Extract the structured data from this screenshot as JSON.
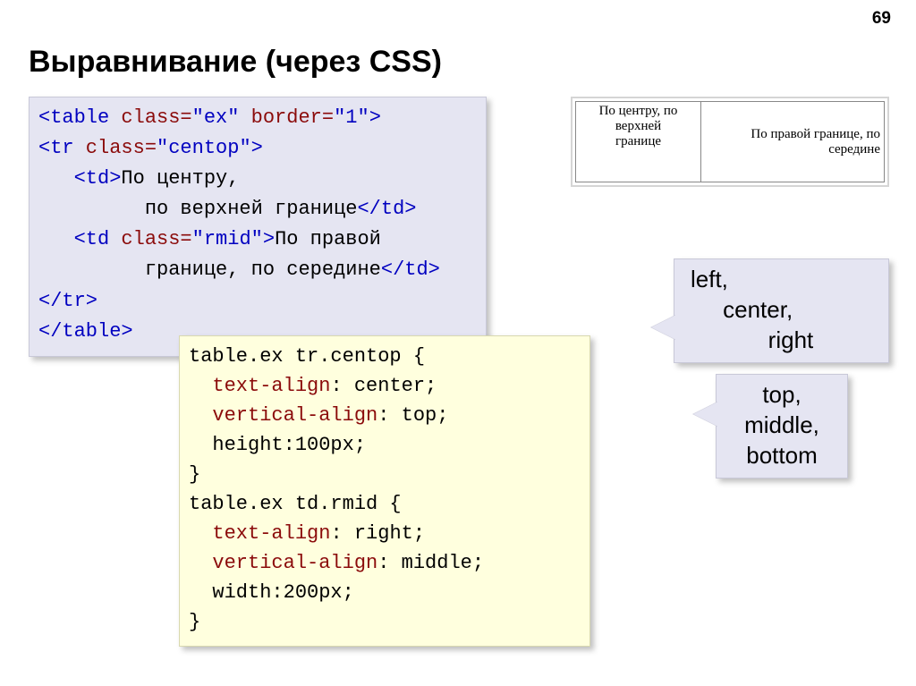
{
  "page_number": "69",
  "title": "Выравнивание (через CSS)",
  "html_code": {
    "l1_a": "<table",
    "l1_b": " class=",
    "l1_c": "\"ex\"",
    "l1_d": " border=",
    "l1_e": "\"1\"",
    "l1_f": ">",
    "l2_a": "<tr",
    "l2_b": " class=",
    "l2_c": "\"centop\"",
    "l2_d": ">",
    "l3_a": "   <td>",
    "l3_b": "По центру,",
    "l4_a": "         по верхней границе",
    "l4_b": "</td>",
    "l5_a": "   <td",
    "l5_b": " class=",
    "l5_c": "\"rmid\"",
    "l5_d": ">",
    "l5_e": "По правой",
    "l6_a": "         границе, по середине",
    "l6_b": "</td>",
    "l7": "</tr>",
    "l8": "</table>"
  },
  "css_code": {
    "l1": "table.ex tr.centop {",
    "l2_a": "  text-align",
    "l2_b": ": center;",
    "l3_a": "  vertical-align",
    "l3_b": ": top;",
    "l4": "  height:100px;",
    "l5": "}",
    "l6": "table.ex td.rmid {",
    "l7_a": "  text-align",
    "l7_b": ": right;",
    "l8_a": "  vertical-align",
    "l8_b": ": middle;",
    "l9": "  width:200px;",
    "l10": "}"
  },
  "example": {
    "cell1_l1": "По центру, по",
    "cell1_l2": "верхней",
    "cell1_l3": "границе",
    "cell2_l1": "По правой границе, по",
    "cell2_l2": "середине"
  },
  "callout1": {
    "l1": "left,",
    "l2": "     center,",
    "l3": "            right"
  },
  "callout2": {
    "l1": "top,",
    "l2": "middle,",
    "l3": "bottom"
  }
}
